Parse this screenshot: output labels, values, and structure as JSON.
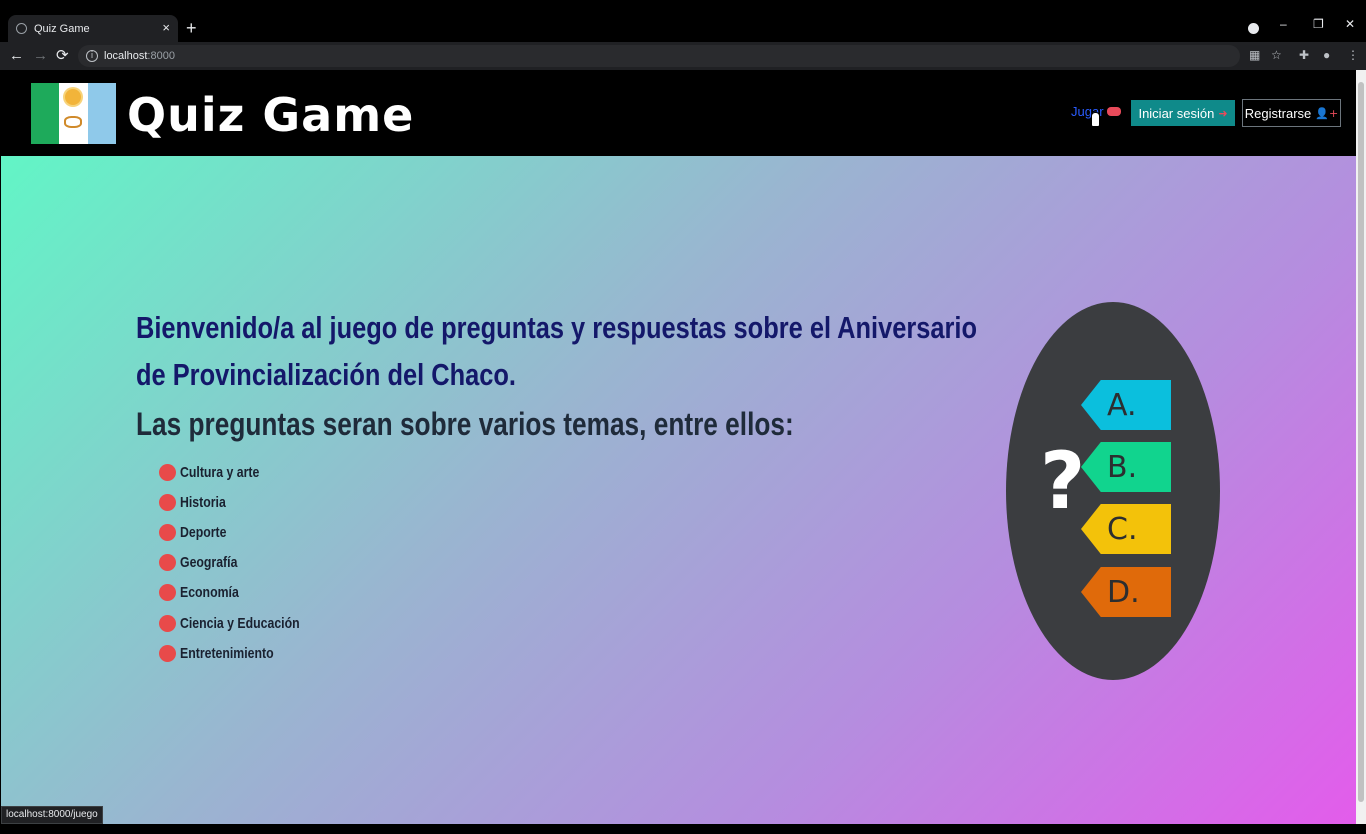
{
  "browser": {
    "tab_title": "Quiz Game",
    "tab_close": "×",
    "new_tab": "+",
    "back": "←",
    "forward": "→",
    "reload": "⟳",
    "url_host": "localhost",
    "url_port": ":8000",
    "window_minimize": "–",
    "window_restore": "❐",
    "window_close": "✕",
    "status_url": "localhost:8000/juego"
  },
  "site": {
    "brand": "Quiz Game",
    "nav": {
      "jugar": "Jugar",
      "login": "Iniciar sesión",
      "register": "Registrarse"
    }
  },
  "hero": {
    "headline": "Bienvenido/a al juego de preguntas y respuestas sobre el Aniversario de Provincialización del Chaco.",
    "subhead": "Las preguntas seran sobre varios temas, entre ellos:",
    "topics": [
      "Cultura y arte",
      "Historia",
      "Deporte",
      "Geografía",
      "Economía",
      "Ciencia y Educación",
      "Entretenimiento"
    ]
  },
  "illustration": {
    "question_mark": "?",
    "options": [
      {
        "label": "A.",
        "color": "#0bbfdd"
      },
      {
        "label": "B.",
        "color": "#11d48e"
      },
      {
        "label": "C.",
        "color": "#f3c20a"
      },
      {
        "label": "D.",
        "color": "#e06a0a"
      }
    ]
  },
  "colors": {
    "header_bg": "#000000",
    "login_button": "#0f8a8a",
    "jugar_link": "#2a5cff",
    "accent_red": "#e84a5a",
    "headline_text": "#14186a"
  }
}
